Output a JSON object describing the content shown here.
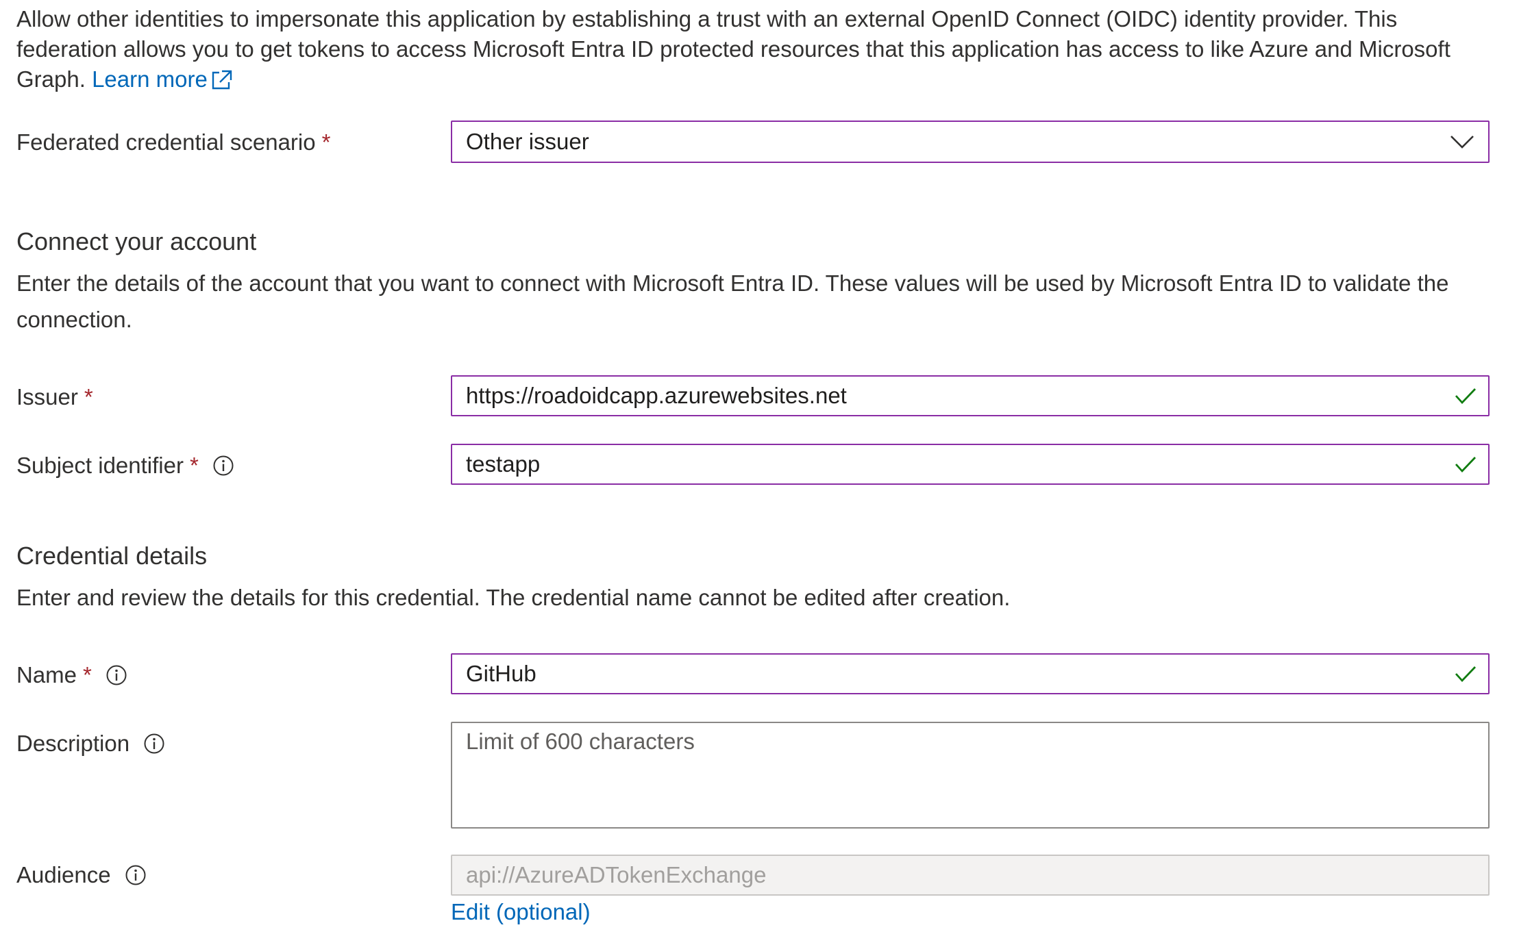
{
  "intro": {
    "text": "Allow other identities to impersonate this application by establishing a trust with an external OpenID Connect (OIDC) identity provider. This federation allows you to get tokens to access Microsoft Entra ID protected resources that this application has access to like Azure and Microsoft Graph.",
    "learn_more": "Learn more"
  },
  "scenario": {
    "label": "Federated credential scenario",
    "required_mark": "*",
    "value": "Other issuer"
  },
  "connect_section": {
    "heading": "Connect your account",
    "description": "Enter the details of the account that you want to connect with Microsoft Entra ID. These values will be used by Microsoft Entra ID to validate the connection."
  },
  "issuer": {
    "label": "Issuer",
    "required_mark": "*",
    "value": "https://roadoidcapp.azurewebsites.net"
  },
  "subject": {
    "label": "Subject identifier",
    "required_mark": "*",
    "value": "testapp"
  },
  "credential_section": {
    "heading": "Credential details",
    "description": "Enter and review the details for this credential. The credential name cannot be edited after creation."
  },
  "name": {
    "label": "Name",
    "required_mark": "*",
    "value": "GitHub"
  },
  "description_field": {
    "label": "Description",
    "placeholder": "Limit of 600 characters"
  },
  "audience": {
    "label": "Audience",
    "value": "api://AzureADTokenExchange",
    "edit_link": "Edit (optional)"
  },
  "colors": {
    "accent_border": "#8a2da5",
    "link": "#0067b8",
    "required": "#a4262c",
    "valid_check": "#107c10"
  },
  "icons": {
    "external_link": "external-link-icon",
    "dropdown": "chevron-down-icon",
    "valid": "checkmark-icon",
    "info": "info-icon"
  }
}
